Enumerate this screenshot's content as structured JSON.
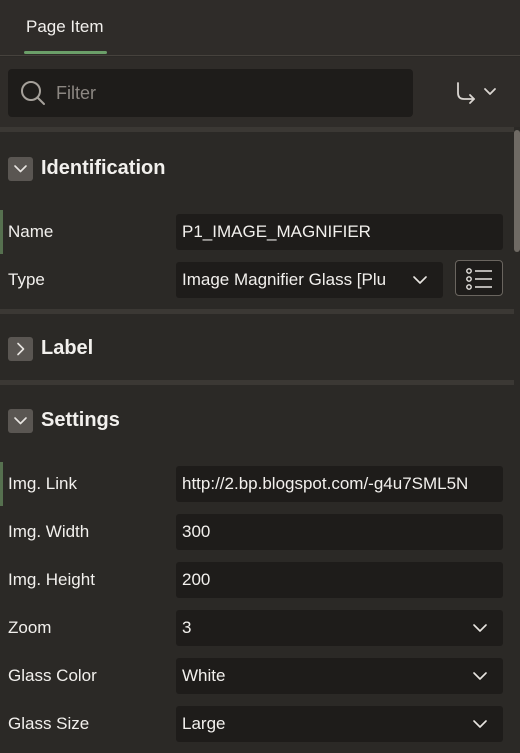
{
  "tabs": [
    {
      "label": "Page Item"
    }
  ],
  "search": {
    "placeholder": "Filter"
  },
  "sections": {
    "identification": {
      "title": "Identification",
      "expanded": true
    },
    "label": {
      "title": "Label",
      "expanded": false
    },
    "settings": {
      "title": "Settings",
      "expanded": true
    }
  },
  "identification": {
    "name": {
      "label": "Name",
      "value": "P1_IMAGE_MAGNIFIER"
    },
    "type": {
      "label": "Type",
      "value": "Image Magnifier Glass [Plu"
    }
  },
  "settings": {
    "img_link": {
      "label": "Img. Link",
      "value": "http://2.bp.blogspot.com/-g4u7SML5N"
    },
    "img_width": {
      "label": "Img. Width",
      "value": "300"
    },
    "img_height": {
      "label": "Img. Height",
      "value": "200"
    },
    "zoom": {
      "label": "Zoom",
      "value": "3"
    },
    "glass_color": {
      "label": "Glass Color",
      "value": "White"
    },
    "glass_size": {
      "label": "Glass Size",
      "value": "Large"
    }
  },
  "icons": {
    "search": "search-icon",
    "goto": "goto-arrow-icon",
    "chevron": "chevron-down-icon",
    "list": "list-icon",
    "expand": "chevron-right-icon",
    "collapse": "chevron-down-icon"
  },
  "colors": {
    "background": "#2b2926",
    "field": "#1e1c1a",
    "accent": "#6b9f69",
    "text": "#f2f0ed",
    "placeholder": "#8c8782"
  }
}
